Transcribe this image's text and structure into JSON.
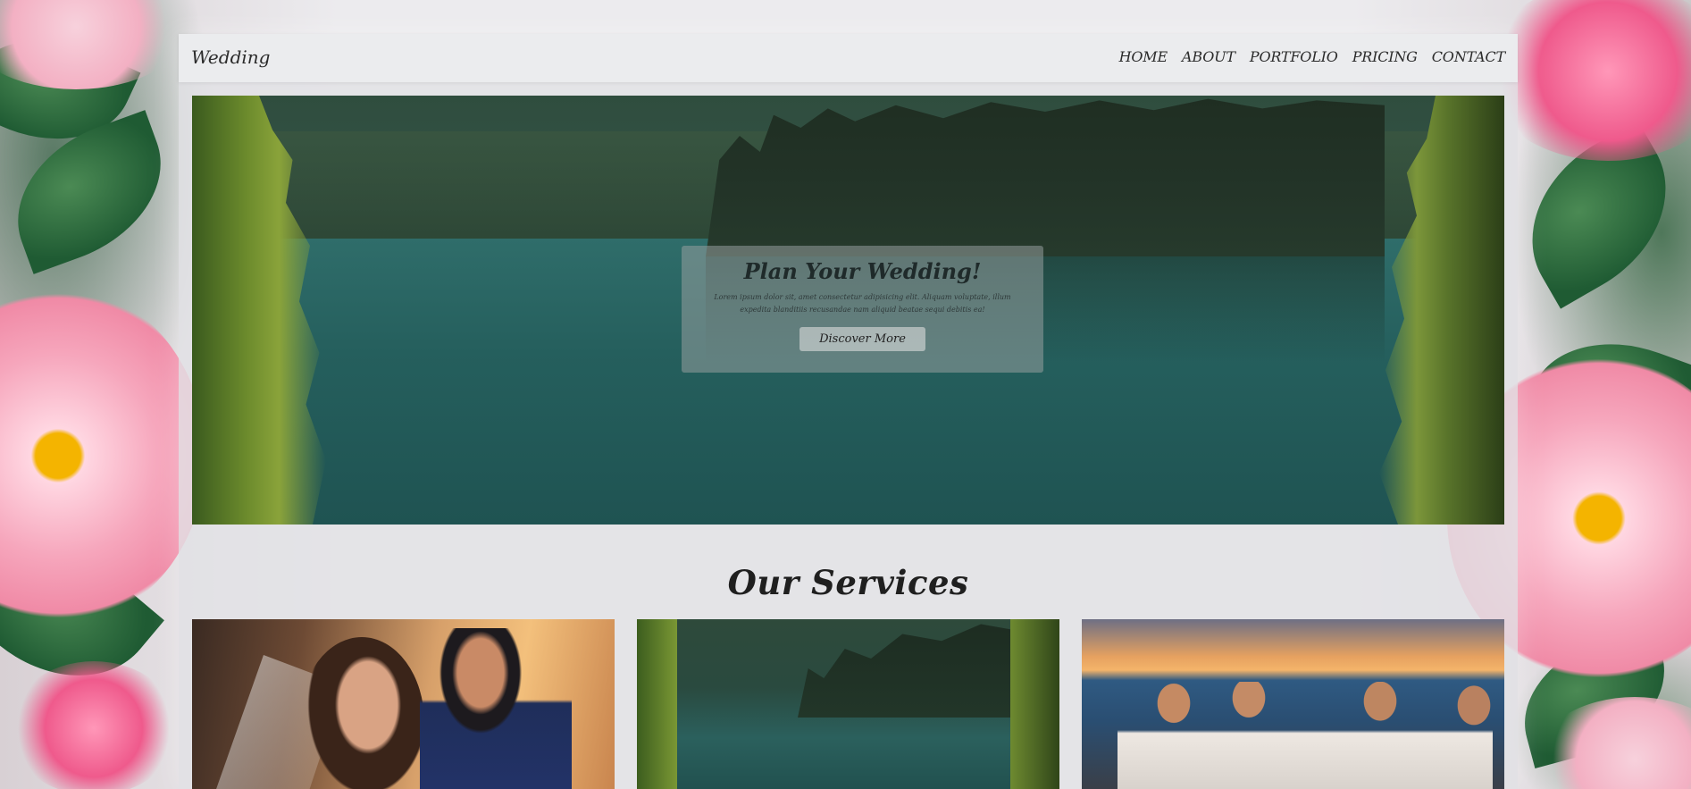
{
  "navbar": {
    "brand": "Wedding",
    "links": [
      "HOME",
      "ABOUT",
      "PORTFOLIO",
      "PRICING",
      "CONTACT"
    ]
  },
  "hero": {
    "title": "Plan Your Wedding!",
    "text": "Lorem ipsum dolor sit, amet consectetur adipisicing elit. Aliquam voluptate, illum expedita blanditiis recusandae nam aliquid beatae sequi debitis ea!",
    "button_label": "Discover More"
  },
  "services": {
    "title": "Our Services",
    "cards": [
      {
        "image": "bride-and-groom-sunset-photo"
      },
      {
        "image": "forest-lake-photo"
      },
      {
        "image": "beach-celebration-photo"
      }
    ]
  },
  "colors": {
    "text_dark": "#2b2b2b",
    "container": "#e2e2e5",
    "hero_card": "#969e9e"
  }
}
